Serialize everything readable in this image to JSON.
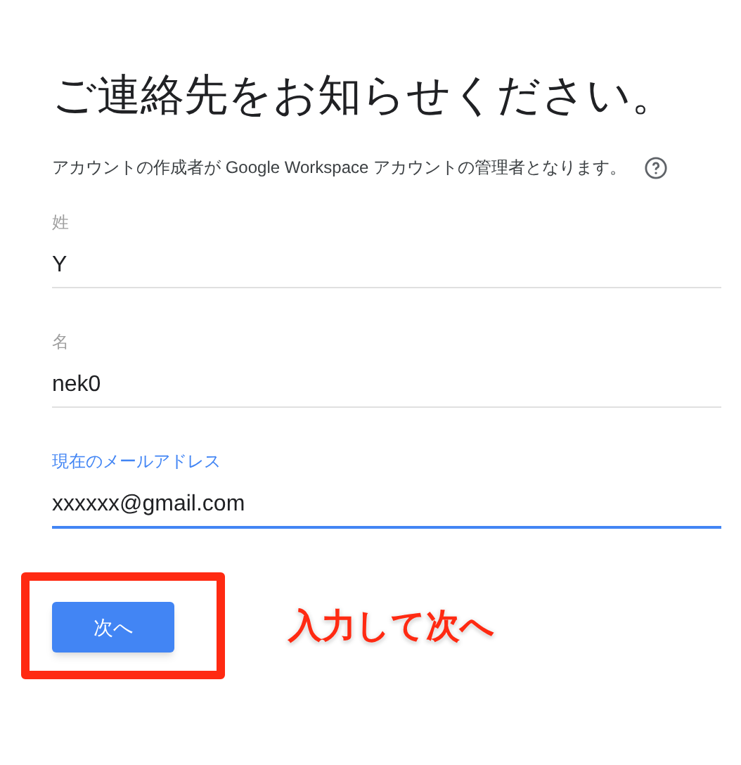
{
  "title": "ご連絡先をお知らせください。",
  "description": "アカウントの作成者が Google Workspace アカウントの管理者となります。",
  "fields": [
    {
      "label": "姓",
      "value": "Y",
      "focused": false
    },
    {
      "label": "名",
      "value": "nek0",
      "focused": false
    },
    {
      "label": "現在のメールアドレス",
      "value": "xxxxxx@gmail.com",
      "focused": true
    }
  ],
  "next_button": "次へ",
  "annotation": {
    "text": "入力して次へ"
  }
}
